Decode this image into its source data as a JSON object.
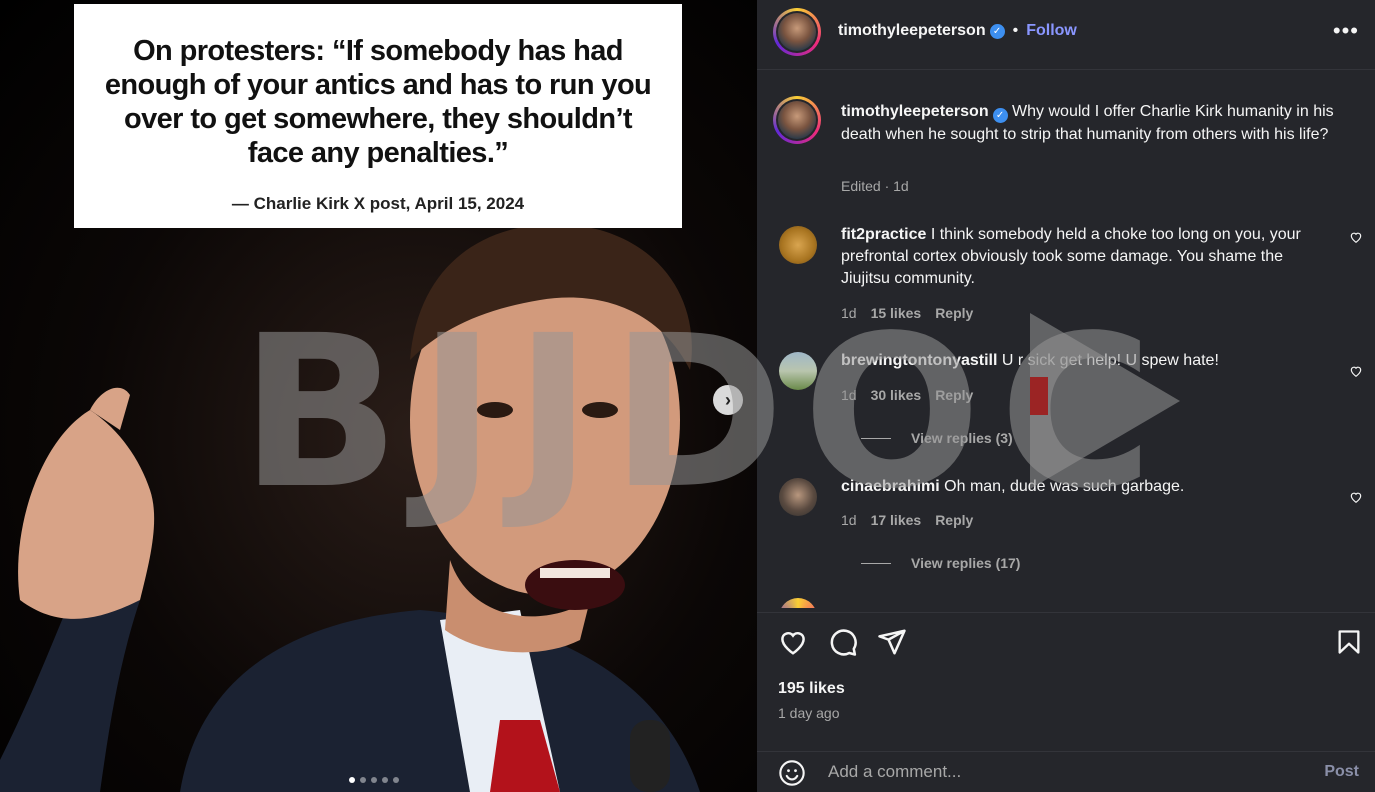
{
  "media": {
    "quote": "On protesters: “If somebody has had enough of your antics and has to run you over to get somewhere, they shouldn’t face any penalties.”",
    "attribution": "— Charlie Kirk X post, April 15, 2024",
    "watermark": "BJJDOC",
    "carousel": {
      "dots": 5,
      "active": 1
    }
  },
  "header": {
    "username": "timothyleepeterson",
    "separator": "•",
    "follow_label": "Follow",
    "more_label": "•••"
  },
  "caption": {
    "username": "timothyleepeterson",
    "text": "Why would I offer Charlie Kirk humanity in his death when he sought to strip that humanity from others with his life?",
    "meta": "Edited · 1d"
  },
  "comments": [
    {
      "username": "fit2practice",
      "text": "I think somebody held a choke too long on you, your prefrontal cortex obviously took some damage. You shame the Jiujitsu community.",
      "time": "1d",
      "likes": "15 likes",
      "reply": "Reply"
    },
    {
      "username": "brewingtontonyastill",
      "text": "U r sick get help! U spew hate!",
      "time": "1d",
      "likes": "30 likes",
      "reply": "Reply",
      "view_replies": "View replies (3)"
    },
    {
      "username": "cinaebrahimi",
      "text": "Oh man, dude was such garbage.",
      "time": "1d",
      "likes": "17 likes",
      "reply": "Reply",
      "view_replies": "View replies (17)"
    }
  ],
  "actions": {
    "likes": "195 likes",
    "time": "1 day ago",
    "add_comment_placeholder": "Add a comment...",
    "post_label": "Post"
  },
  "colors": {
    "panel_bg": "#25262b",
    "follow": "#8a96ff",
    "verified": "#3d8ff0",
    "muted": "#a8a8a8"
  }
}
